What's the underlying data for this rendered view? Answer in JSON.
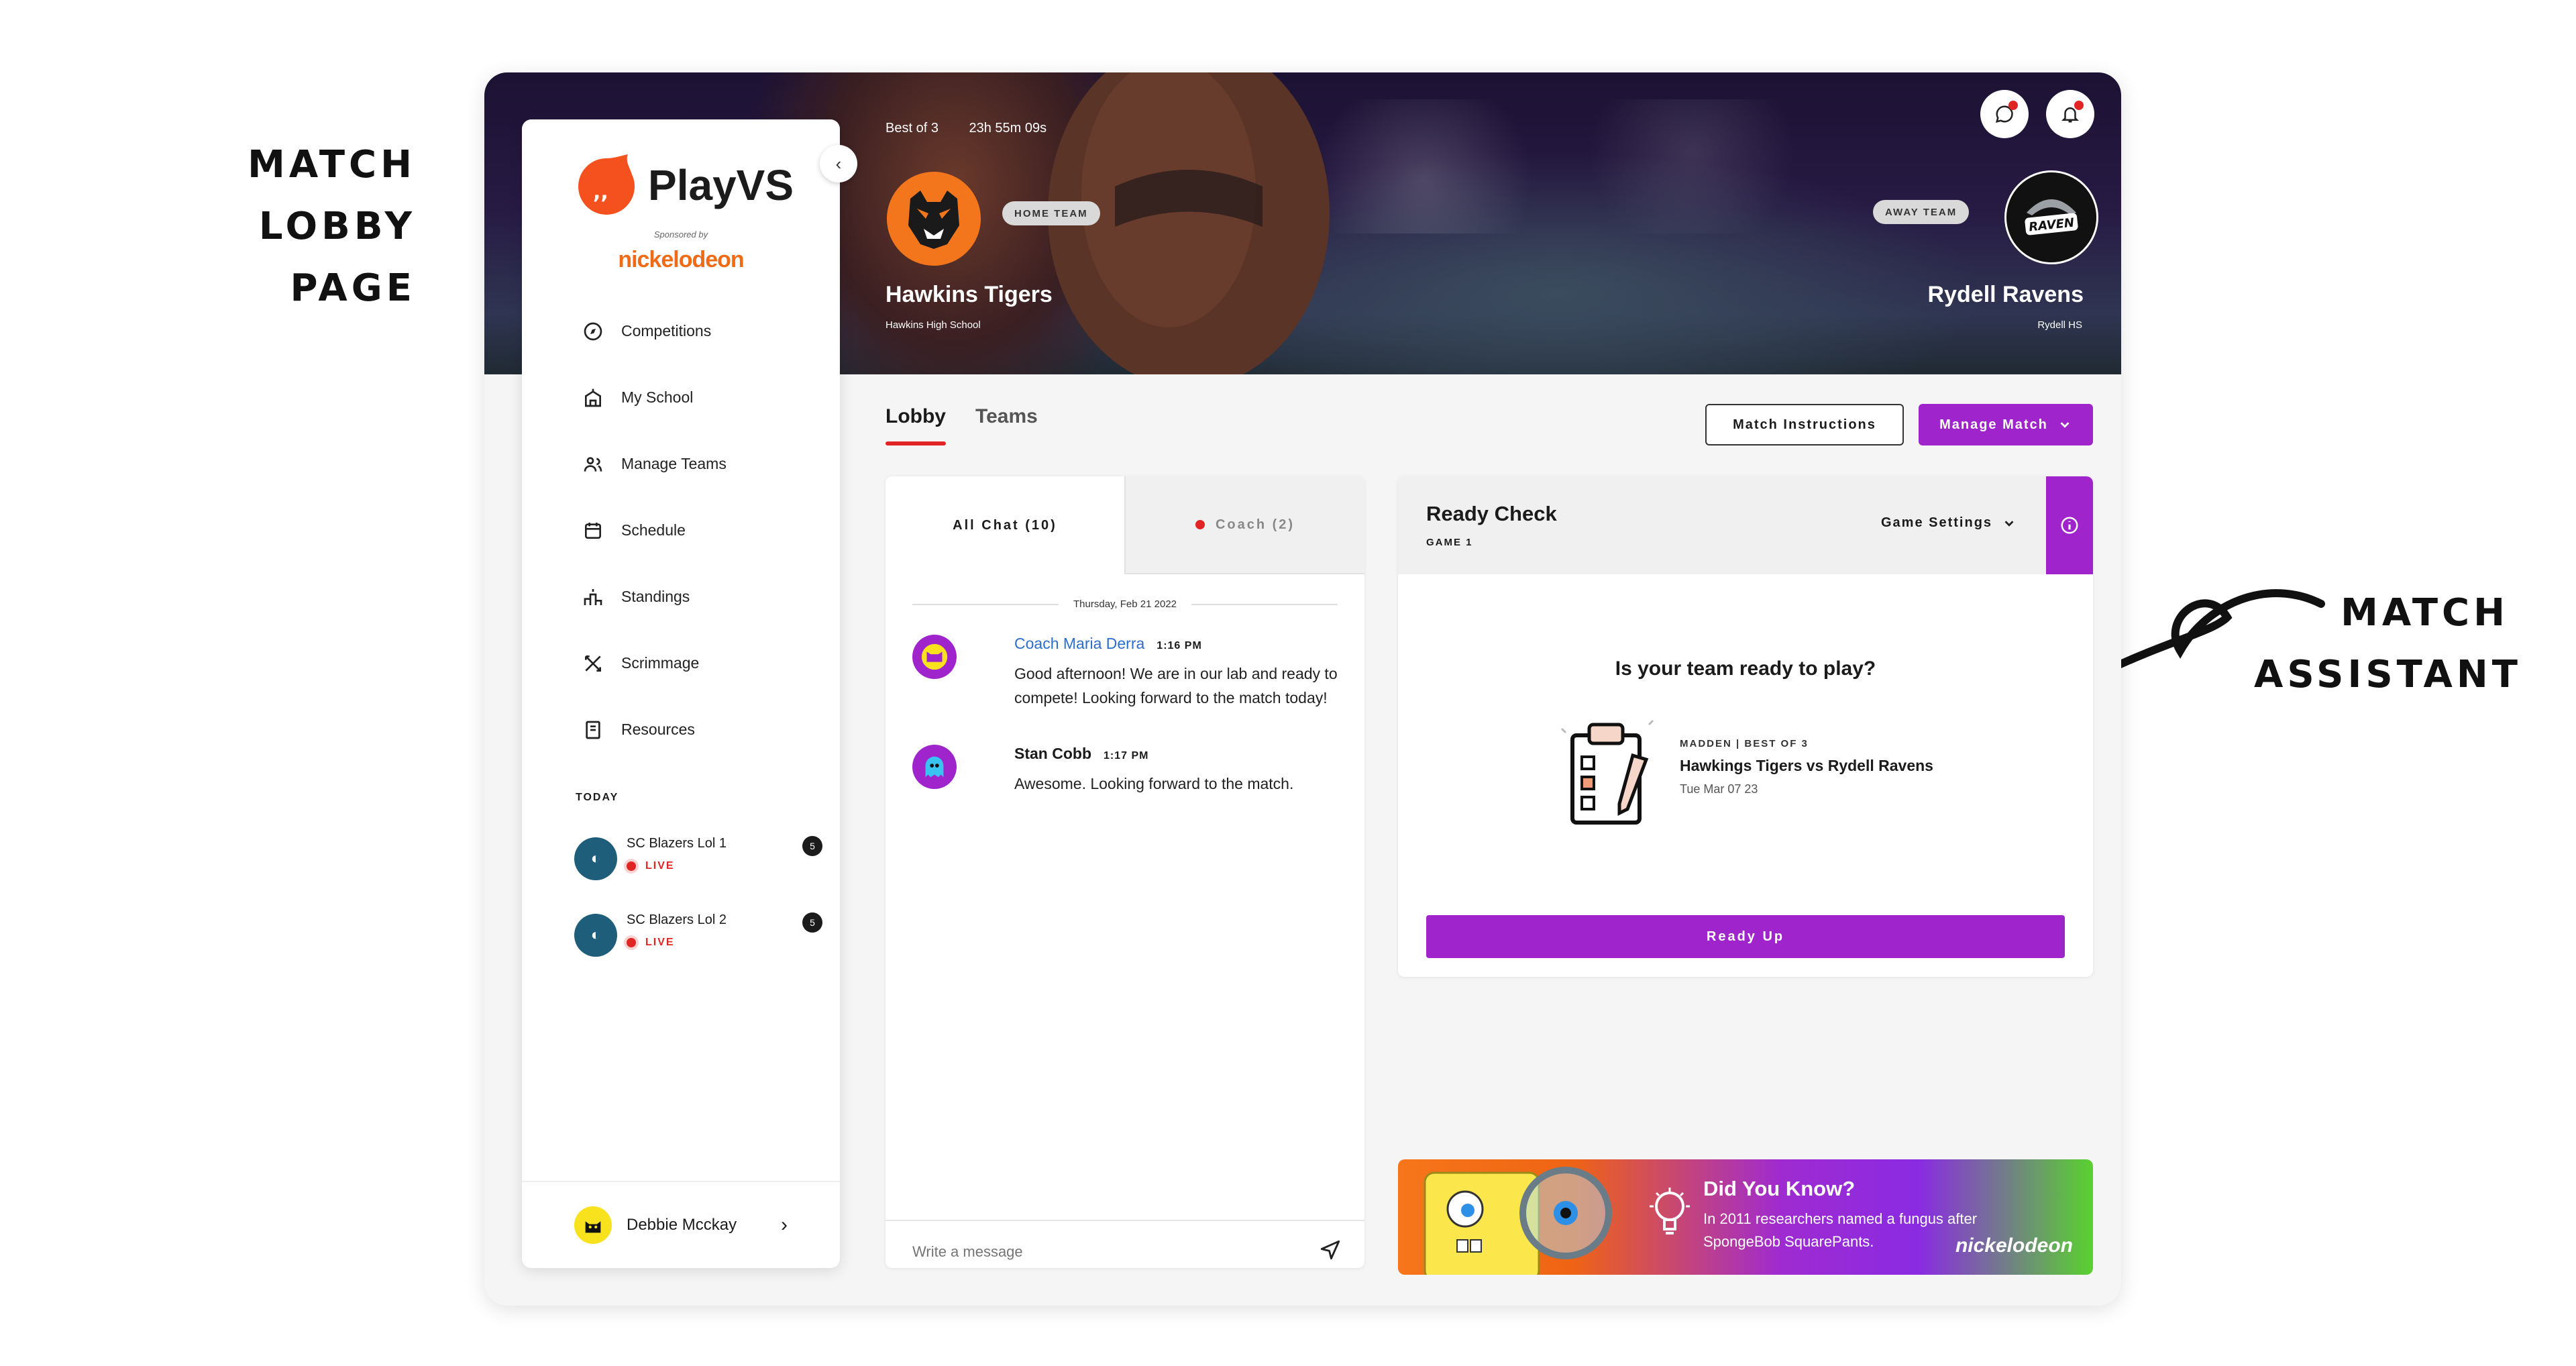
{
  "annotations": {
    "left": [
      "MATCH LOBBY",
      "PAGE"
    ],
    "right": [
      "MATCH",
      "ASSISTANT"
    ]
  },
  "sidebar": {
    "app_name": "PlayVS",
    "sponsored_by": "Sponsored by",
    "sponsor": "nickelodeon",
    "nav": [
      {
        "label": "Competitions",
        "icon": "compass-icon"
      },
      {
        "label": "My School",
        "icon": "school-icon"
      },
      {
        "label": "Manage Teams",
        "icon": "users-icon"
      },
      {
        "label": "Schedule",
        "icon": "calendar-icon"
      },
      {
        "label": "Standings",
        "icon": "podium-icon"
      },
      {
        "label": "Scrimmage",
        "icon": "crossed-swords-icon"
      },
      {
        "label": "Resources",
        "icon": "book-icon"
      }
    ],
    "today_label": "TODAY",
    "matches": [
      {
        "name": "SC Blazers Lol 1",
        "status": "LIVE",
        "unread": "5"
      },
      {
        "name": "SC Blazers Lol 2",
        "status": "LIVE",
        "unread": "5"
      }
    ],
    "user": {
      "name": "Debbie Mcckay"
    }
  },
  "hero": {
    "format": "Best of 3",
    "countdown": "23h 55m 09s",
    "home": {
      "badge": "HOME TEAM",
      "name": "Hawkins Tigers",
      "school": "Hawkins High School"
    },
    "away": {
      "badge": "AWAY TEAM",
      "name": "Rydell Ravens",
      "school": "Rydell HS",
      "logo_text": "RAVEN"
    }
  },
  "tabs": {
    "lobby": "Lobby",
    "teams": "Teams"
  },
  "actions": {
    "instructions": "Match Instructions",
    "manage": "Manage Match"
  },
  "chat": {
    "tab_all": "All Chat (10)",
    "tab_coach": "Coach (2)",
    "date": "Thursday, Feb 21 2022",
    "messages": [
      {
        "author": "Coach Maria Derra",
        "time": "1:16 PM",
        "text": "Good afternoon! We are in our lab and ready to compete! Looking forward to the match today!"
      },
      {
        "author": "Stan Cobb",
        "time": "1:17 PM",
        "text": "Awesome. Looking forward to the match."
      }
    ],
    "placeholder": "Write a message"
  },
  "ready_check": {
    "title": "Ready Check",
    "game": "GAME 1",
    "settings": "Game Settings",
    "question": "Is your team ready to play?",
    "match_label": "MADDEN | BEST OF 3",
    "match_title": "Hawkings Tigers vs Rydell Ravens",
    "match_date": "Tue Mar 07 23",
    "button": "Ready Up"
  },
  "ad": {
    "title": "Did You Know?",
    "text": "In 2011 researchers named a fungus after SpongeBob SquarePants.",
    "brand": "nickelodeon"
  },
  "colors": {
    "accent": "#9f24cc",
    "live": "#e12424",
    "brand_orange": "#f06b14"
  }
}
